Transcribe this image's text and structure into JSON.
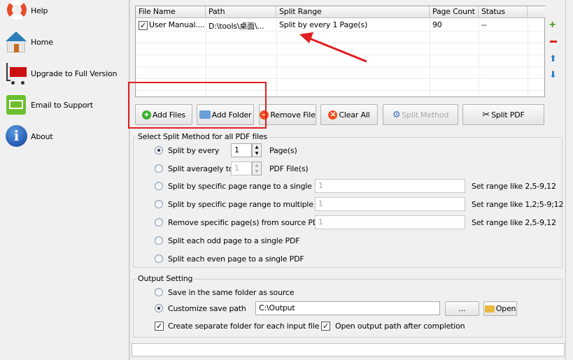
{
  "sidebar": {
    "items": [
      {
        "label": "Help",
        "icon": "lifebuoy-icon"
      },
      {
        "label": "Home",
        "icon": "home-icon"
      },
      {
        "label": "Upgrade to Full Version",
        "icon": "cart-icon"
      },
      {
        "label": "Email to Support",
        "icon": "email-icon"
      },
      {
        "label": "About",
        "icon": "info-icon"
      }
    ]
  },
  "table": {
    "columns": [
      "File Name",
      "Path",
      "Split Range",
      "Page Count",
      "Status"
    ],
    "rows": [
      {
        "checked": true,
        "file_name": "User Manual....",
        "path": "D:\\tools\\桌面\\...",
        "split_range": "Split by every 1 Page(s)",
        "page_count": "90",
        "status": "--"
      }
    ]
  },
  "buttons": {
    "add_files": "Add Files",
    "add_folder": "Add Folder",
    "remove_file": "Remove File",
    "clear_all": "Clear All",
    "split_method": "Split Method",
    "split_pdf": "Split PDF"
  },
  "split": {
    "title": "Select Split Method for all PDF files",
    "every": {
      "label": "Split by every",
      "value": "1",
      "unit": "Page(s)"
    },
    "average": {
      "label": "Split averagely to",
      "value": "1",
      "unit": "PDF File(s)"
    },
    "range_single": {
      "label": "Split by specific page range to a single PDF",
      "value": "1",
      "hint": "Set range like 2,5-9,12"
    },
    "range_multi": {
      "label": "Split by specific page range to multiple PDF",
      "value": "1",
      "hint": "Set range like 1,2;5-9;12"
    },
    "remove": {
      "label": "Remove specific page(s) from source PDF",
      "value": "1",
      "hint": "Set range like 2,5-9,12"
    },
    "odd": {
      "label": "Split each odd page to a single PDF"
    },
    "even": {
      "label": "Split each even page to a single PDF"
    },
    "selected": "every"
  },
  "output": {
    "title": "Output Setting",
    "same_folder": "Save in the same folder as source",
    "customize": "Customize save path",
    "path": "C:\\Output",
    "browse": "...",
    "open": "Open",
    "separate_folder": "Create separate folder for each input file",
    "separate_checked": true,
    "open_after": "Open output path after completion",
    "open_after_checked": true,
    "selected": "customize"
  },
  "annotation_color": "#e02020"
}
